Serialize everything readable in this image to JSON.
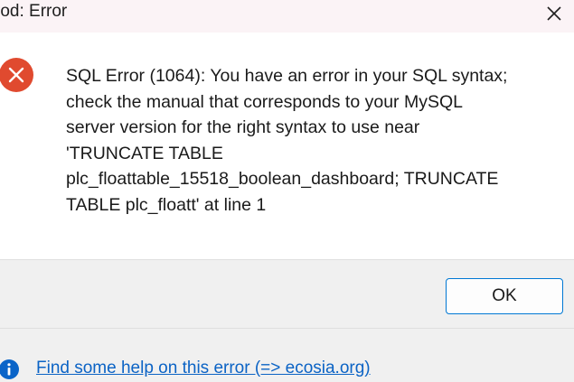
{
  "window": {
    "title": "rod: Error",
    "close_icon": "close-icon"
  },
  "error": {
    "icon": "error-icon",
    "icon_color": "#e04a2f",
    "message": "SQL Error (1064): You have an error in your SQL syntax;\ncheck the manual that corresponds to your MySQL\nserver version for the right syntax to use near\n'TRUNCATE TABLE\nplc_floattable_15518_boolean_dashboard; TRUNCATE\nTABLE plc_floatt' at line 1"
  },
  "buttons": {
    "ok_label": "OK"
  },
  "footer": {
    "info_icon": "info-icon",
    "info_icon_color": "#0a64c8",
    "help_link": "Find some help on this error (=> ecosia.org)"
  },
  "colors": {
    "accent": "#0078d4",
    "link": "#0b63c5",
    "titlebar_bg": "#fbf3f6",
    "panel_bg": "#f0f0f0"
  }
}
